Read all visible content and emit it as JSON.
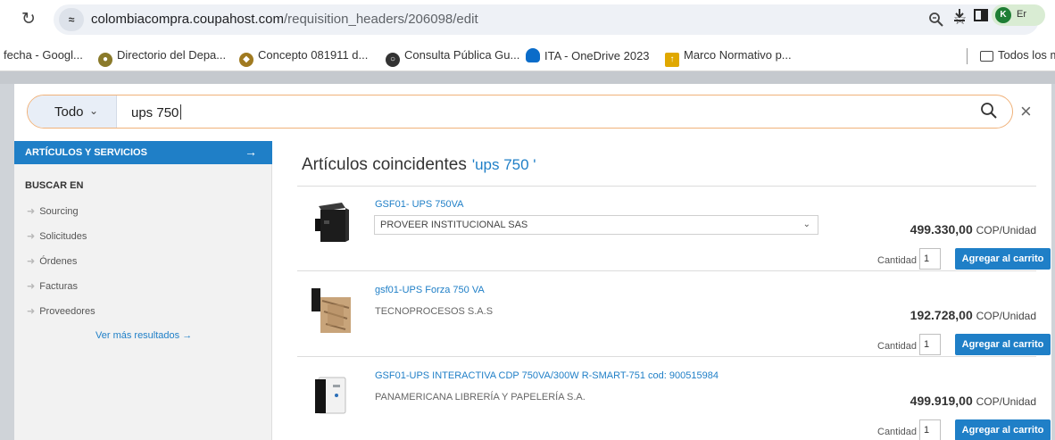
{
  "browser": {
    "url_host": "colombiacompra.coupahost.com",
    "url_path": "/requisition_headers/206098/edit",
    "avatar_letter": "K",
    "avatar_text": "Er",
    "bookmarks": [
      {
        "label": "fecha - Googl...",
        "icon": "none"
      },
      {
        "label": "Directorio del Depa...",
        "icon": "seal-icon"
      },
      {
        "label": "Concepto 081911 d...",
        "icon": "shield-icon"
      },
      {
        "label": "Consulta Pública Gu...",
        "icon": "globe-icon"
      },
      {
        "label": "ITA - OneDrive 2023",
        "icon": "cloud-icon"
      },
      {
        "label": "Marco Normativo p...",
        "icon": "arrow-icon"
      }
    ],
    "all_bookmarks_label": "Todos los m"
  },
  "search": {
    "scope": "Todo",
    "query": "ups 750"
  },
  "sidebar": {
    "header": "ARTÍCULOS Y SERVICIOS",
    "section": "BUSCAR EN",
    "items": [
      "Sourcing",
      "Solicitudes",
      "Órdenes",
      "Facturas",
      "Proveedores"
    ],
    "more": "Ver más resultados →"
  },
  "results": {
    "title": "Artículos coincidentes",
    "query_display": "'ups 750 '",
    "qty_label": "Cantidad",
    "add_label": "Agregar al carrito",
    "unit": "COP/Unidad",
    "items": [
      {
        "name": "GSF01- UPS 750VA",
        "supplier": "PROVEER INSTITUCIONAL SAS",
        "price": "499.330,00",
        "qty": "1"
      },
      {
        "name": "gsf01-UPS Forza 750 VA",
        "supplier": "TECNOPROCESOS S.A.S",
        "price": "192.728,00",
        "qty": "1"
      },
      {
        "name": "GSF01-UPS INTERACTIVA CDP 750VA/300W R-SMART-751 cod: 900515984",
        "supplier": "PANAMERICANA LIBRERÍA Y PAPELERÍA S.A.",
        "price": "499.919,00",
        "qty": "1"
      }
    ]
  }
}
